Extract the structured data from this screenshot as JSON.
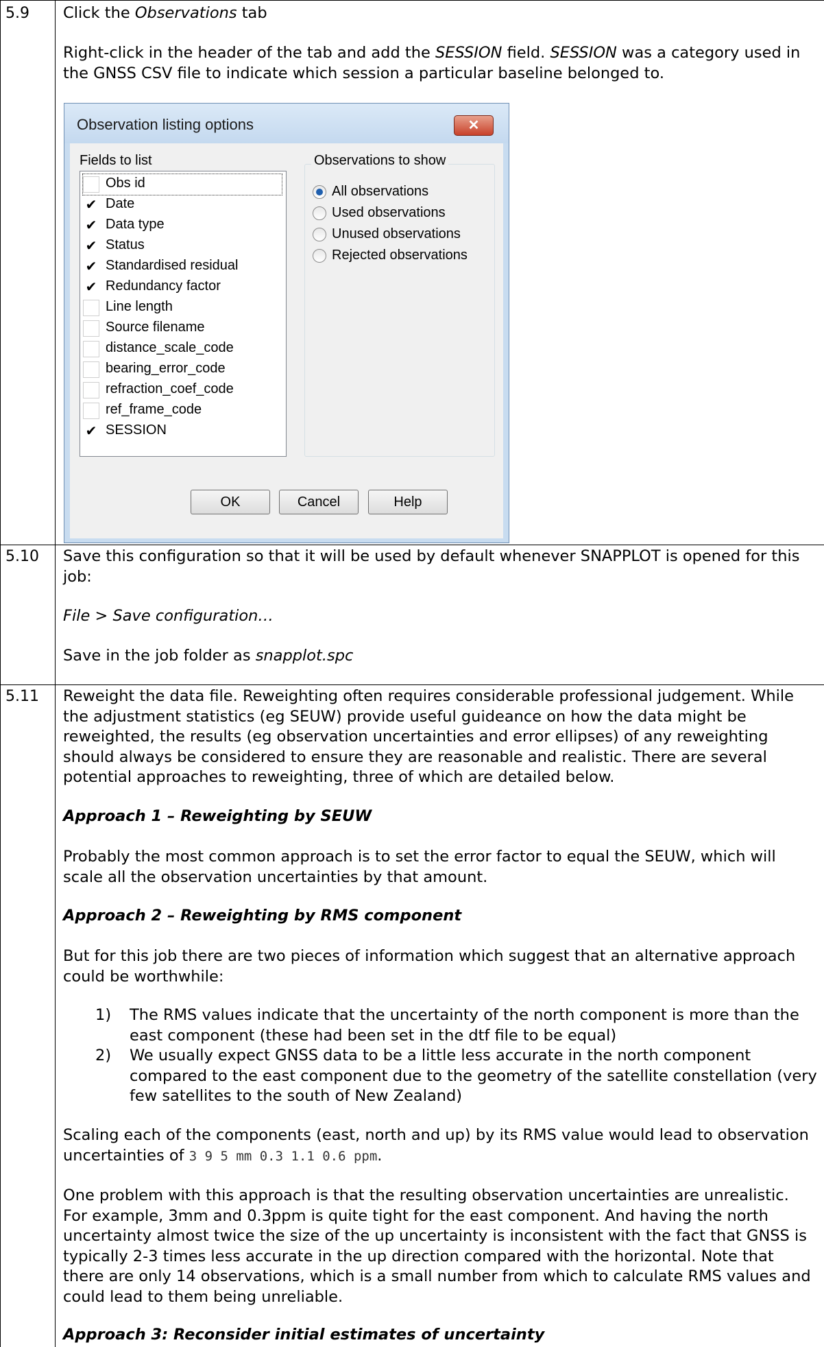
{
  "steps": [
    {
      "num": "5.9"
    },
    {
      "num": "5.10"
    },
    {
      "num": "5.11"
    }
  ],
  "s59": {
    "p1_a": "Click the ",
    "p1_em": "Observations",
    "p1_b": " tab",
    "p2_a": "Right-click in the header of the tab and add the ",
    "p2_em1": "SESSION",
    "p2_b": " field. ",
    "p2_em2": "SESSION",
    "p2_c": " was a category used in the GNSS CSV file to indicate which session a particular baseline belonged to."
  },
  "dialog": {
    "title": "Observation listing options",
    "close_glyph": "✕",
    "fields_label": "Fields to list",
    "check_glyph": "✔",
    "fields": [
      {
        "label": "Obs id",
        "checked": false
      },
      {
        "label": "Date",
        "checked": true
      },
      {
        "label": "Data type",
        "checked": true
      },
      {
        "label": "Status",
        "checked": true
      },
      {
        "label": "Standardised residual",
        "checked": true
      },
      {
        "label": "Redundancy factor",
        "checked": true
      },
      {
        "label": "Line length",
        "checked": false
      },
      {
        "label": "Source filename",
        "checked": false
      },
      {
        "label": "distance_scale_code",
        "checked": false
      },
      {
        "label": "bearing_error_code",
        "checked": false
      },
      {
        "label": "refraction_coef_code",
        "checked": false
      },
      {
        "label": "ref_frame_code",
        "checked": false
      },
      {
        "label": "SESSION",
        "checked": true
      }
    ],
    "show_label": "Observations to show",
    "show_options": [
      {
        "label": "All observations",
        "selected": true
      },
      {
        "label": "Used observations",
        "selected": false
      },
      {
        "label": "Unused observations",
        "selected": false
      },
      {
        "label": "Rejected observations",
        "selected": false
      }
    ],
    "ok": "OK",
    "cancel": "Cancel",
    "help": "Help"
  },
  "s510": {
    "p1": "Save this configuration so that it will be used by default whenever SNAPPLOT is opened for this job:",
    "p2": "File > Save configuration…",
    "p3_a": "Save in the job folder as ",
    "p3_em": "snapplot.spc"
  },
  "s511": {
    "intro": "Reweight the data file. Reweighting often requires considerable professional judgement. While the adjustment statistics (eg SEUW) provide useful guideance on how the data might be reweighted, the results (eg observation uncertainties and error ellipses) of any reweighting should always be considered to ensure they are reasonable and realistic. There are several potential approaches to reweighting, three of which are detailed below.",
    "h1": "Approach 1 – Reweighting by SEUW",
    "p1": "Probably the most common approach is to set the error factor to equal the SEUW, which will scale all the observation uncertainties by that amount.",
    "h2": "Approach 2 – Reweighting by RMS component",
    "p2": "But for this job there are two pieces of information which suggest that an alternative approach could be worthwhile:",
    "list": [
      {
        "n": "1)",
        "text": "The RMS values indicate that the uncertainty of the north component is more than the east component (these had been set in the dtf file to be equal)"
      },
      {
        "n": "2)",
        "text": "We usually expect GNSS data to be a little less accurate in the north component compared to the east component due to the geometry of the satellite constellation (very few satellites to the south of New Zealand)"
      }
    ],
    "p3_a": "Scaling each of the components (east, north and up) by its RMS value would lead to observation uncertainties of ",
    "p3_code": "3 9 5 mm 0.3 1.1 0.6 ppm",
    "p3_b": ".",
    "p4": "One problem with this approach is that the resulting observation uncertainties are unrealistic. For example, 3mm and 0.3ppm is quite tight for the east component. And having the north uncertainty almost twice the size of the up uncertainty is inconsistent with the fact that GNSS is typically 2-3 times less accurate in the up direction compared with the horizontal. Note that there are only 14 observations, which is a small number from which to calculate RMS values and could lead to them being unreliable.",
    "h3": "Approach 3: Reconsider initial estimates of uncertainty"
  }
}
